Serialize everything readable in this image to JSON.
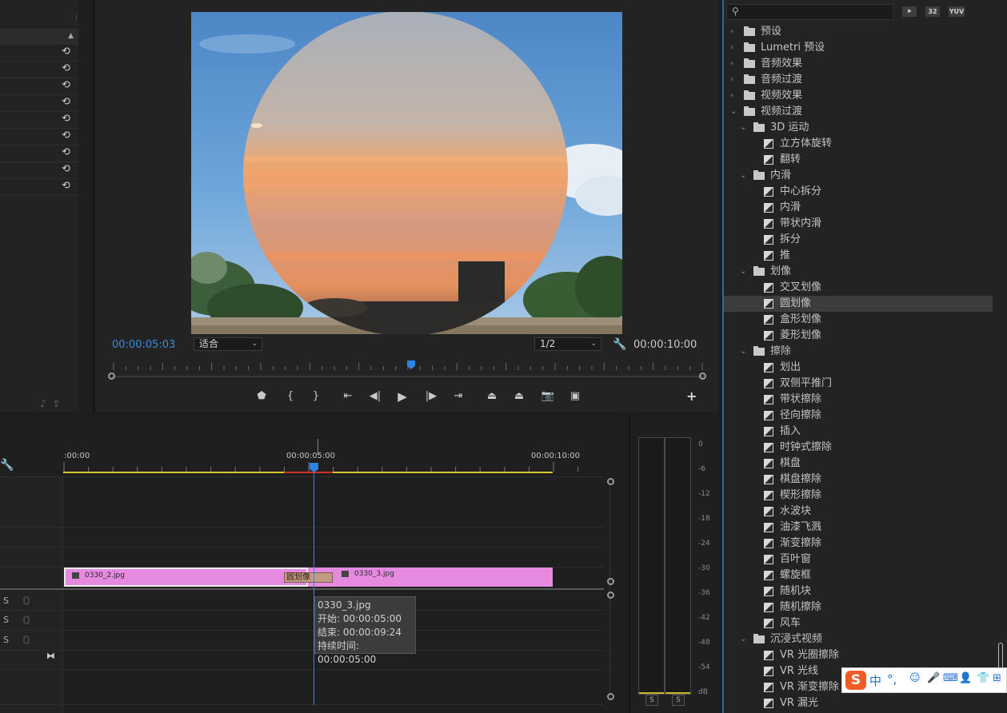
{
  "monitor": {
    "current_timecode": "00:00:05:03",
    "total_timecode": "00:00:10:00",
    "zoom_select": "适合",
    "resolution_select": "1/2",
    "transport_buttons": [
      {
        "name": "add-marker-button",
        "glyph": "⬟"
      },
      {
        "name": "mark-in-button",
        "glyph": "{"
      },
      {
        "name": "mark-out-button",
        "glyph": "}"
      },
      {
        "name": "go-to-in-button",
        "glyph": "⇤"
      },
      {
        "name": "step-back-button",
        "glyph": "◀|"
      },
      {
        "name": "play-button",
        "glyph": "▶"
      },
      {
        "name": "step-forward-button",
        "glyph": "|▶"
      },
      {
        "name": "go-to-out-button",
        "glyph": "⇥"
      },
      {
        "name": "lift-button",
        "glyph": "⏏"
      },
      {
        "name": "extract-button",
        "glyph": "⏏"
      },
      {
        "name": "export-frame-button",
        "glyph": "📷"
      },
      {
        "name": "compare-view-button",
        "glyph": "▣"
      }
    ],
    "add_button": "+"
  },
  "effects_panel": {
    "search_placeholder": "",
    "badges": [
      "32",
      "YUV"
    ],
    "items": [
      {
        "label": "预设",
        "level": 0,
        "kind": "folder",
        "expanded": false
      },
      {
        "label": "Lumetri 预设",
        "level": 0,
        "kind": "folder",
        "expanded": false
      },
      {
        "label": "音频效果",
        "level": 0,
        "kind": "folder",
        "expanded": false
      },
      {
        "label": "音频过渡",
        "level": 0,
        "kind": "folder",
        "expanded": false
      },
      {
        "label": "视频效果",
        "level": 0,
        "kind": "folder",
        "expanded": false
      },
      {
        "label": "视频过渡",
        "level": 0,
        "kind": "folder",
        "expanded": true
      },
      {
        "label": "3D 运动",
        "level": 1,
        "kind": "folder",
        "expanded": true
      },
      {
        "label": "立方体旋转",
        "level": 2,
        "kind": "effect"
      },
      {
        "label": "翻转",
        "level": 2,
        "kind": "effect"
      },
      {
        "label": "内滑",
        "level": 1,
        "kind": "folder",
        "expanded": true
      },
      {
        "label": "中心拆分",
        "level": 2,
        "kind": "effect"
      },
      {
        "label": "内滑",
        "level": 2,
        "kind": "effect"
      },
      {
        "label": "带状内滑",
        "level": 2,
        "kind": "effect"
      },
      {
        "label": "拆分",
        "level": 2,
        "kind": "effect"
      },
      {
        "label": "推",
        "level": 2,
        "kind": "effect"
      },
      {
        "label": "划像",
        "level": 1,
        "kind": "folder",
        "expanded": true
      },
      {
        "label": "交叉划像",
        "level": 2,
        "kind": "effect"
      },
      {
        "label": "圆划像",
        "level": 2,
        "kind": "effect",
        "selected": true
      },
      {
        "label": "盒形划像",
        "level": 2,
        "kind": "effect"
      },
      {
        "label": "菱形划像",
        "level": 2,
        "kind": "effect"
      },
      {
        "label": "擦除",
        "level": 1,
        "kind": "folder",
        "expanded": true
      },
      {
        "label": "划出",
        "level": 2,
        "kind": "effect"
      },
      {
        "label": "双侧平推门",
        "level": 2,
        "kind": "effect"
      },
      {
        "label": "带状擦除",
        "level": 2,
        "kind": "effect"
      },
      {
        "label": "径向擦除",
        "level": 2,
        "kind": "effect"
      },
      {
        "label": "插入",
        "level": 2,
        "kind": "effect"
      },
      {
        "label": "时钟式擦除",
        "level": 2,
        "kind": "effect"
      },
      {
        "label": "棋盘",
        "level": 2,
        "kind": "effect"
      },
      {
        "label": "棋盘擦除",
        "level": 2,
        "kind": "effect"
      },
      {
        "label": "楔形擦除",
        "level": 2,
        "kind": "effect"
      },
      {
        "label": "水波块",
        "level": 2,
        "kind": "effect"
      },
      {
        "label": "油漆飞溅",
        "level": 2,
        "kind": "effect"
      },
      {
        "label": "渐变擦除",
        "level": 2,
        "kind": "effect"
      },
      {
        "label": "百叶窗",
        "level": 2,
        "kind": "effect"
      },
      {
        "label": "螺旋框",
        "level": 2,
        "kind": "effect"
      },
      {
        "label": "随机块",
        "level": 2,
        "kind": "effect"
      },
      {
        "label": "随机擦除",
        "level": 2,
        "kind": "effect"
      },
      {
        "label": "风车",
        "level": 2,
        "kind": "effect"
      },
      {
        "label": "沉浸式视频",
        "level": 1,
        "kind": "folder",
        "expanded": true
      },
      {
        "label": "VR 光圈擦除",
        "level": 2,
        "kind": "effect"
      },
      {
        "label": "VR 光线",
        "level": 2,
        "kind": "effect"
      },
      {
        "label": "VR 渐变擦除",
        "level": 2,
        "kind": "effect"
      },
      {
        "label": "VR 漏光",
        "level": 2,
        "kind": "effect"
      }
    ]
  },
  "timeline": {
    "ruler_labels": [
      ":00:00",
      "00:00:05:00",
      "00:00:10:00"
    ],
    "clip_a_name": "0330_2.jpg",
    "clip_b_name": "0330_3.jpg",
    "transition_label": "圆划像",
    "tooltip": {
      "name": "0330_3.jpg",
      "start": "开始: 00:00:05:00",
      "end": "结束: 00:00:09:24",
      "duration": "持续时间: 00:00:05:00"
    },
    "audio_track_s": [
      "S",
      "S",
      "S"
    ]
  },
  "audio_meter": {
    "db_labels": [
      "0",
      "-6",
      "-12",
      "-18",
      "-24",
      "-30",
      "-36",
      "-42",
      "-48",
      "-54",
      "dB"
    ],
    "solo_buttons": [
      "S",
      "S"
    ]
  },
  "ime": {
    "logo": "S",
    "items": [
      "中",
      "°,",
      "☺",
      "🎤",
      "⌨",
      "👤",
      "👕",
      "⊞"
    ]
  },
  "colors": {
    "accent_blue": "#3d8ae0",
    "clip_pink": "#e68ae0",
    "work_area_yellow": "#d8c92b",
    "transition_tan": "#c29a86"
  }
}
